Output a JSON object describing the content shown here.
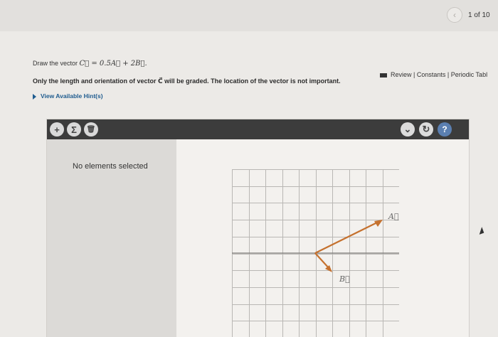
{
  "header": {
    "page_counter": "1 of 10",
    "prev_icon": "chevron-left-icon"
  },
  "resources": {
    "text": "Review | Constants | Periodic Tabl"
  },
  "problem": {
    "prompt_prefix": "Draw the vector ",
    "equation": "C⃗ = 0.5A⃗ + 2B⃗.",
    "grade_note_prefix": "Only the length and orientation of vector ",
    "grade_note_vector": "C⃗",
    "grade_note_suffix": " will be graded. The location of the vector is not important.",
    "hints_label": "View Available Hint(s)"
  },
  "toolbar": {
    "add_symbol": "+",
    "sum_symbol": "Σ",
    "delete_symbol": "🗑",
    "dropdown_symbol": "⌄",
    "reset_symbol": "↻",
    "help_symbol": "?"
  },
  "elements_panel": {
    "message": "No elements selected"
  },
  "vectors": {
    "a_label": "A⃗",
    "b_label": "B⃗"
  },
  "colors": {
    "vector": "#c5712e",
    "link": "#1f5c8f",
    "help_button": "#5b7fb0"
  }
}
